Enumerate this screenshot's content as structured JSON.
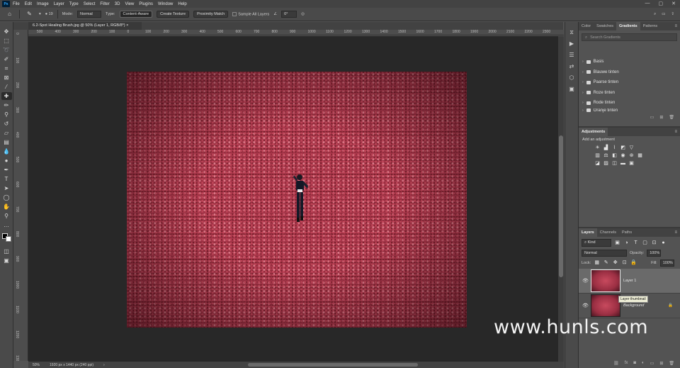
{
  "menubar": {
    "logo": "Ps",
    "items": [
      "File",
      "Edit",
      "Image",
      "Layer",
      "Type",
      "Select",
      "Filter",
      "3D",
      "View",
      "Plugins",
      "Window",
      "Help"
    ]
  },
  "options": {
    "brush_size": "19",
    "mode_label": "Mode:",
    "mode_value": "Normal",
    "type_label": "Type:",
    "type_buttons": [
      "Content-Aware",
      "Create Texture",
      "Proximity Match"
    ],
    "sample_all_label": "Sample All Layers",
    "angle_value": "0°"
  },
  "document": {
    "tab_title": "6.2-Spot Healing Brush.jpg @ 50% (Layer 1, RGB/8*) ×",
    "zoom": "50%",
    "dimensions": "1920 px x 1440 px (240 ppi)"
  },
  "ruler": {
    "h_ticks": [
      "500",
      "400",
      "300",
      "200",
      "100",
      "0",
      "100",
      "200",
      "300",
      "400",
      "500",
      "600",
      "700",
      "800",
      "900",
      "1000",
      "1100",
      "1200",
      "1300",
      "1400",
      "1500",
      "1600",
      "1700",
      "1800",
      "1900",
      "2000",
      "2100",
      "2200",
      "2300"
    ],
    "v_ticks": [
      "0",
      "100",
      "200",
      "300",
      "400",
      "500",
      "600",
      "700",
      "800",
      "900",
      "1000",
      "1100",
      "1200",
      "1300"
    ]
  },
  "gradients_panel": {
    "tabs": [
      "Color",
      "Swatches",
      "Gradients",
      "Patterns"
    ],
    "active_tab": "Gradients",
    "search_placeholder": "Search Gradients",
    "folders": [
      "Basis",
      "Blauwe tinten",
      "Paarse tinten",
      "Roze tinten",
      "Rode tinten",
      "Oranje tinten"
    ]
  },
  "adjustments_panel": {
    "title": "Adjustments",
    "hint": "Add an adjustment"
  },
  "layers_panel": {
    "tabs": [
      "Layers",
      "Channels",
      "Paths"
    ],
    "active_tab": "Layers",
    "filter_label": "Kind",
    "blend_mode": "Normal",
    "opacity_label": "Opacity:",
    "opacity_value": "100%",
    "lock_label": "Lock:",
    "fill_label": "Fill:",
    "fill_value": "100%",
    "layers": [
      {
        "name": "Layer 1",
        "selected": true
      },
      {
        "name": "Background",
        "selected": false
      }
    ],
    "tooltip": "Layer thumbnail"
  },
  "watermark": "www.hunls.com",
  "colors": {
    "accent": "#31a8ff",
    "pasteboard": "#282828",
    "panel": "#535353",
    "image_base": "#a8364a"
  }
}
